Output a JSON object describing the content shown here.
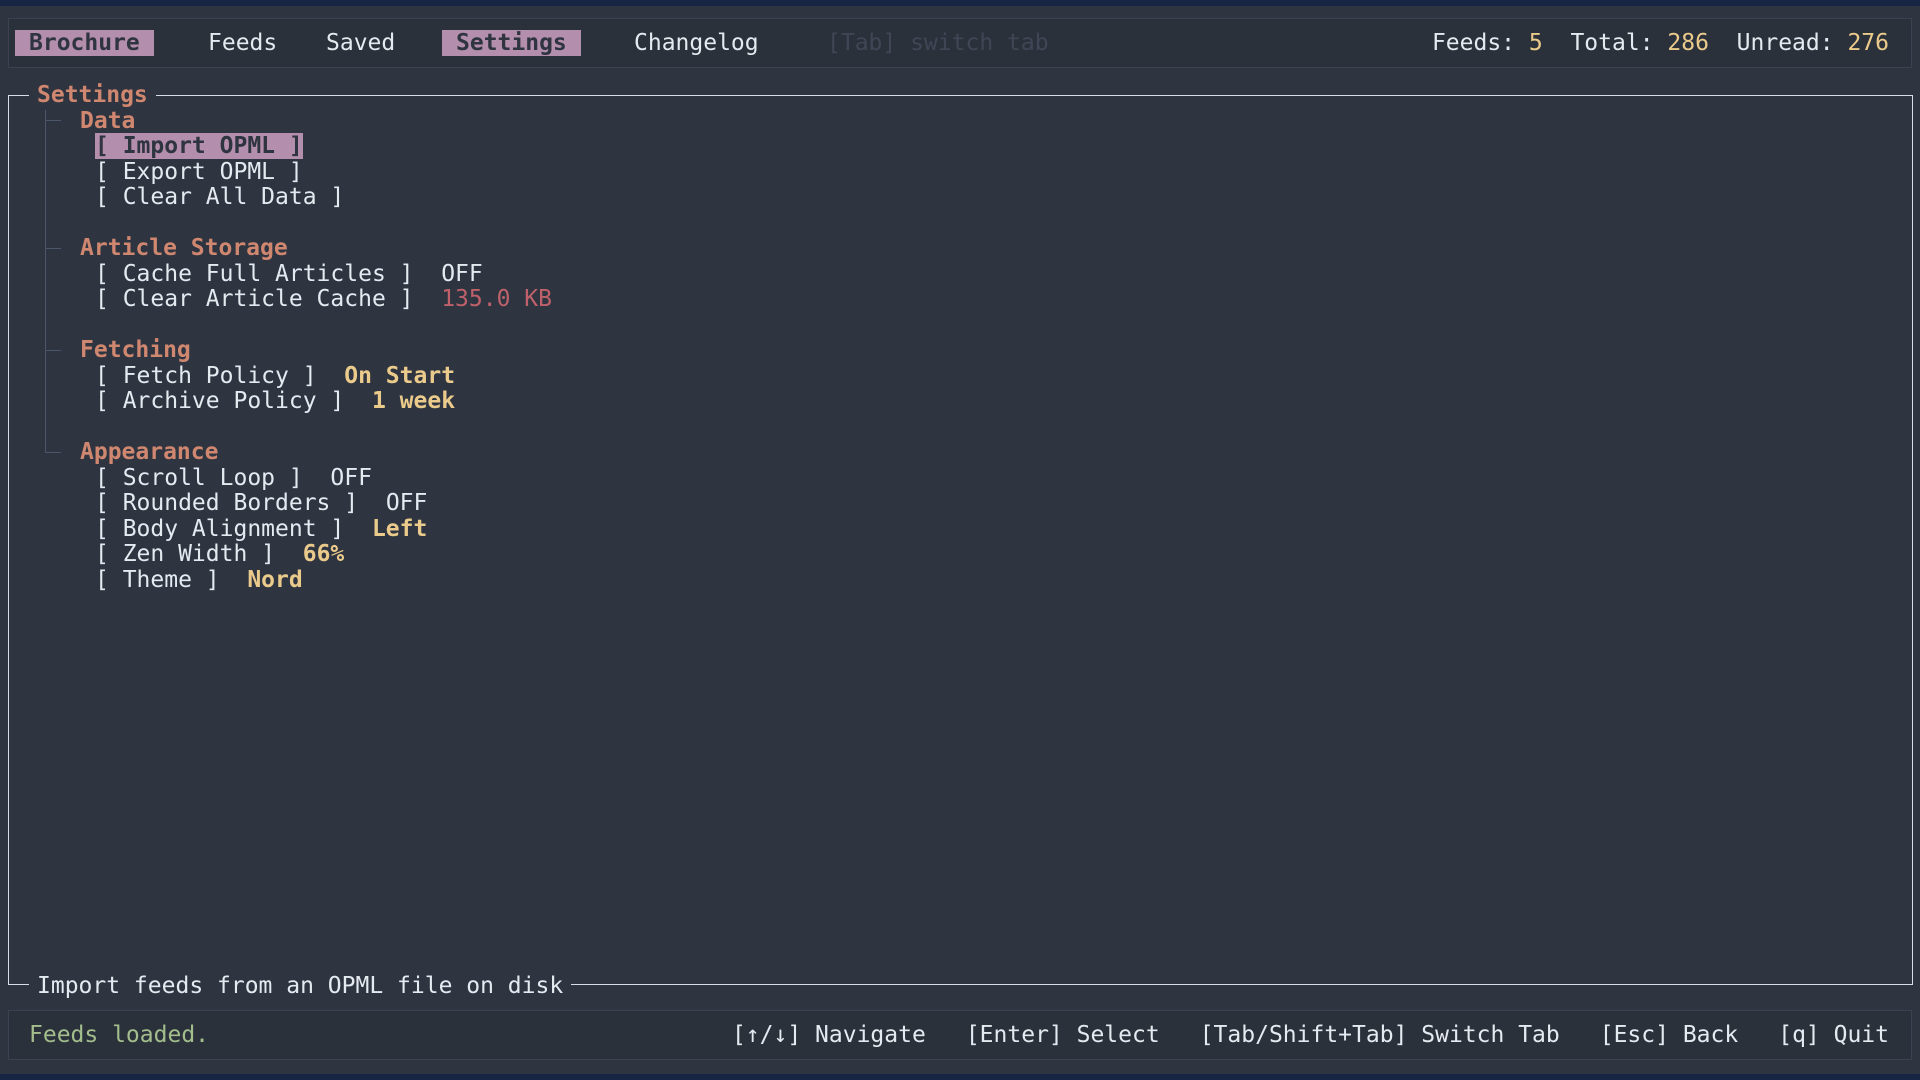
{
  "tabs": [
    {
      "label": "Brochure",
      "active": true
    },
    {
      "label": "Feeds",
      "active": false
    },
    {
      "label": "Saved",
      "active": false
    },
    {
      "label": "Settings",
      "active": true
    },
    {
      "label": "Changelog",
      "active": false
    }
  ],
  "tab_hint": "[Tab] switch tab",
  "stats": {
    "feeds_label": "Feeds:",
    "feeds_value": "5",
    "total_label": "Total:",
    "total_value": "286",
    "unread_label": "Unread:",
    "unread_value": "276"
  },
  "panel": {
    "title": "Settings",
    "description": "Import feeds from an OPML file on disk"
  },
  "sections": {
    "data": {
      "title": "Data",
      "items": [
        "[ Import OPML ]",
        "[ Export OPML ]",
        "[ Clear All Data ]"
      ]
    },
    "storage": {
      "title": "Article Storage",
      "items": [
        {
          "label": "[ Cache Full Articles ]",
          "value": "OFF"
        },
        {
          "label": "[ Clear Article Cache ]",
          "value": "135.0 KB"
        }
      ]
    },
    "fetching": {
      "title": "Fetching",
      "items": [
        {
          "label": "[ Fetch Policy ]",
          "value": "On Start"
        },
        {
          "label": "[ Archive Policy ]",
          "value": "1 week"
        }
      ]
    },
    "appearance": {
      "title": "Appearance",
      "items": [
        {
          "label": "[ Scroll Loop ]",
          "value": "OFF"
        },
        {
          "label": "[ Rounded Borders ]",
          "value": "OFF"
        },
        {
          "label": "[ Body Alignment ]",
          "value": "Left"
        },
        {
          "label": "[ Zen Width ]",
          "value": "66%"
        },
        {
          "label": "[ Theme ]",
          "value": "Nord"
        }
      ]
    }
  },
  "footer": {
    "status": "Feeds loaded.",
    "keys": [
      "[↑/↓] Navigate",
      "[Enter] Select",
      "[Tab/Shift+Tab] Switch Tab",
      "[Esc] Back",
      "[q] Quit"
    ]
  },
  "colors": {
    "background": "#2e3440",
    "accent": "#b48ead",
    "section": "#d08770",
    "value": "#ebcb8b",
    "warning": "#bf616a",
    "status": "#a3be8c"
  }
}
